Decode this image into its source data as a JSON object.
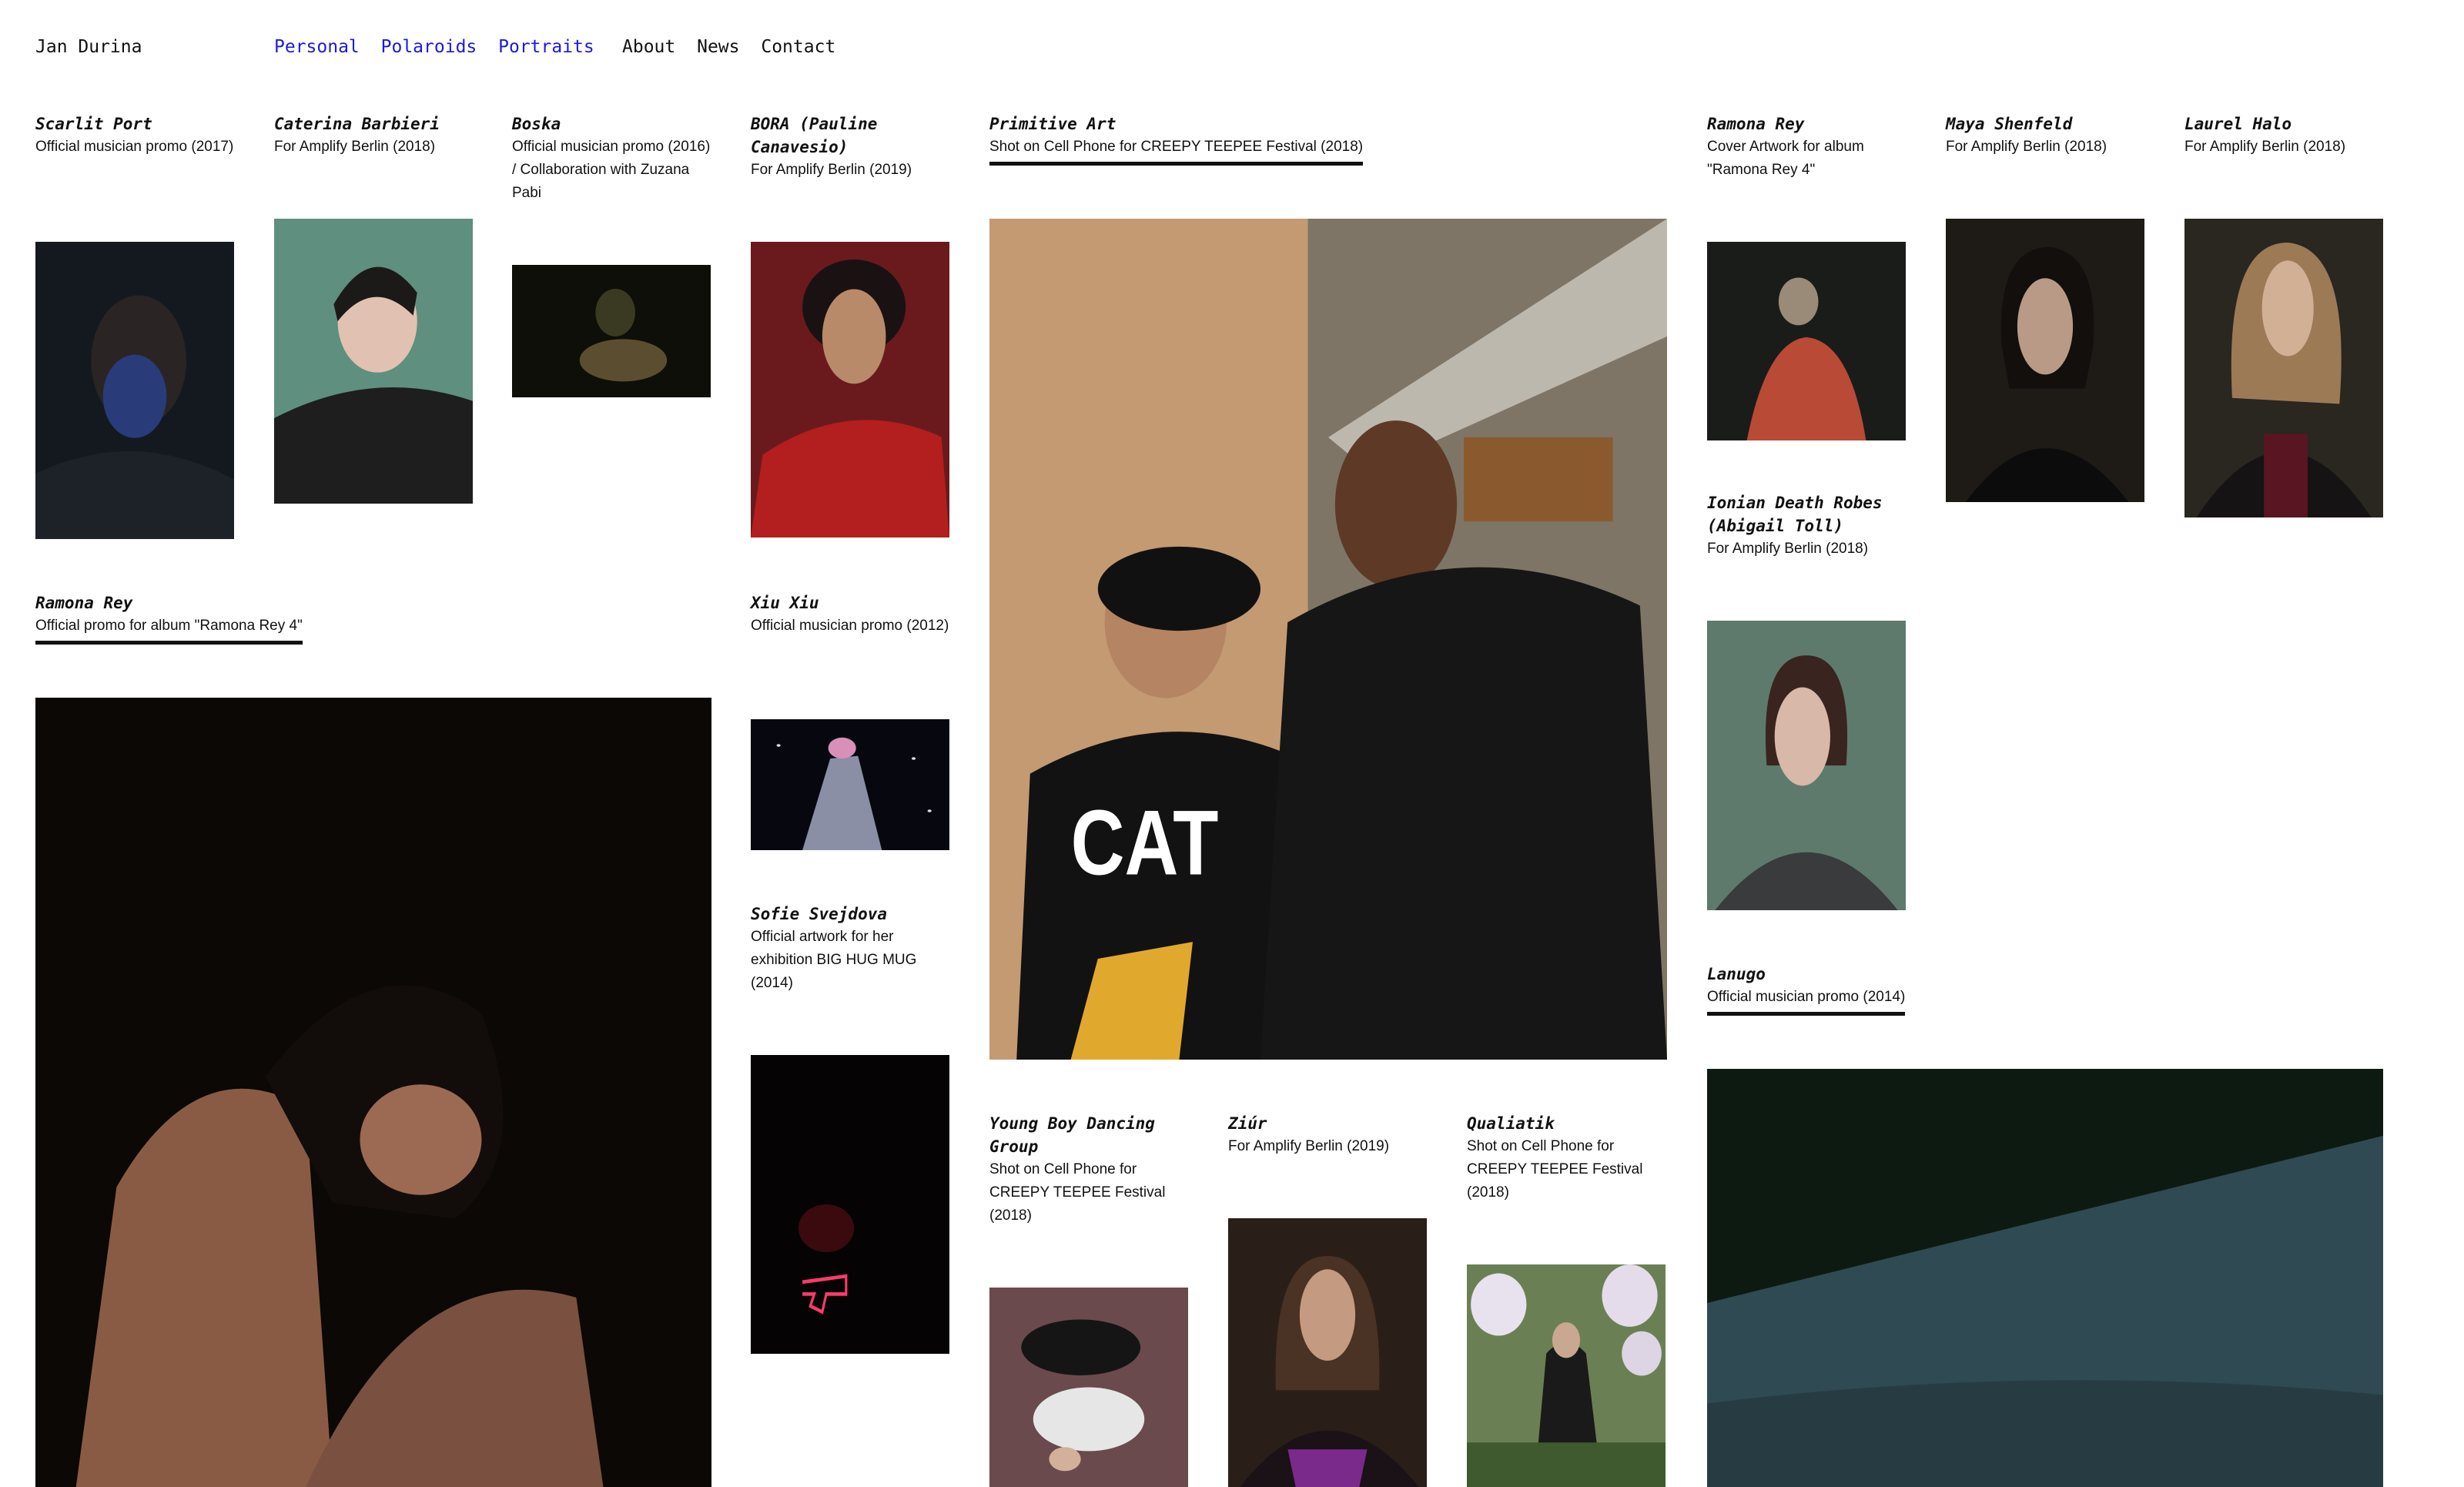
{
  "header": {
    "brand": "Jan Durina",
    "categories": [
      "Personal",
      "Polaroids",
      "Portraits"
    ],
    "pages": [
      "About",
      "News",
      "Contact"
    ],
    "accent_color": "#1a1adc"
  },
  "items": [
    {
      "title": "Scarlit Port",
      "desc": "Official musician promo (2017)",
      "photo": "scarlit-port-photo"
    },
    {
      "title": "Caterina Barbieri",
      "desc": "For Amplify Berlin (2018)",
      "photo": "caterina-barbieri-photo"
    },
    {
      "title": "Boska",
      "desc": "Official musician promo (2016) / Collaboration with Zuzana Pabi",
      "photo": "boska-photo"
    },
    {
      "title": "BORA (Pauline Canavesio)",
      "desc": "For Amplify Berlin (2019)",
      "photo": "bora-photo"
    },
    {
      "title": "Primitive Art",
      "desc": "Shot on Cell Phone for CREEPY TEEPEE Festival (2018)",
      "photo": "primitive-art-photo"
    },
    {
      "title": "Ramona Rey",
      "desc": "Cover Artwork for album \"Ramona Rey 4\"",
      "photo": "ramona-rey-cover-photo"
    },
    {
      "title": "Maya Shenfeld",
      "desc": "For Amplify Berlin (2018)",
      "photo": "maya-shenfeld-photo"
    },
    {
      "title": "Laurel Halo",
      "desc": "For Amplify Berlin (2018)",
      "photo": "laurel-halo-photo"
    },
    {
      "title": "Ramona Rey",
      "desc": "Official promo for album \"Ramona Rey 4\"",
      "photo": "ramona-rey-promo-photo"
    },
    {
      "title": "Xiu Xiu",
      "desc": "Official musician promo (2012)",
      "photo": "xiu-xiu-photo"
    },
    {
      "title": "Ionian Death Robes (Abigail Toll)",
      "desc": "For Amplify Berlin (2018)",
      "photo": "ionian-death-robes-photo"
    },
    {
      "title": "Sofie Svejdova",
      "desc": "Official artwork for her exhibition BIG HUG MUG (2014)",
      "photo": "sofie-svejdova-photo"
    },
    {
      "title": "Lanugo",
      "desc": "Official musician promo (2014)",
      "photo": "lanugo-photo"
    },
    {
      "title": "Young Boy Dancing Group",
      "desc": "Shot on Cell Phone for CREEPY TEEPEE Festival (2018)",
      "photo": "young-boy-dancing-group-photo"
    },
    {
      "title": "Ziúr",
      "desc": "For Amplify Berlin (2019)",
      "photo": "ziur-photo"
    },
    {
      "title": "Qualiatik",
      "desc": "Shot on Cell Phone for CREEPY TEEPEE Festival (2018)",
      "photo": "qualiatik-photo"
    }
  ],
  "photo_text": {
    "shirt_logo": "CAT"
  }
}
